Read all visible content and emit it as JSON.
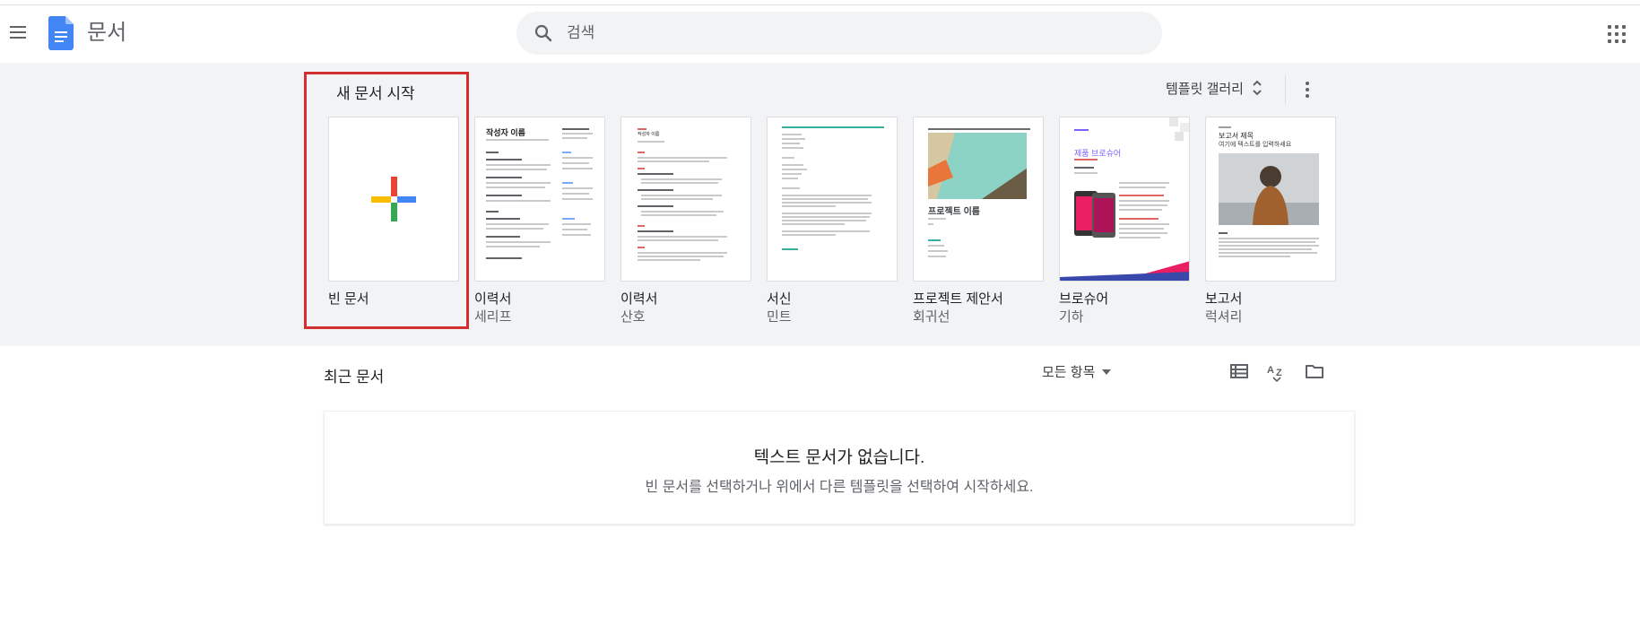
{
  "app": {
    "title": "문서",
    "menu_icon": "hamburger-menu-icon",
    "logo_icon": "docs-logo-icon",
    "apps_icon": "google-apps-grid-icon",
    "brand_color": "#4285f4"
  },
  "search": {
    "placeholder": "검색",
    "value": "",
    "icon": "search-icon"
  },
  "start": {
    "title": "새 문서 시작",
    "gallery_label": "템플릿 갤러리",
    "gallery_icon": "unfold-more-icon",
    "more_icon": "more-vert-icon",
    "highlight_color": "#d32f2f",
    "templates": [
      {
        "title": "빈 문서",
        "subtitle": ""
      },
      {
        "title": "이력서",
        "subtitle": "세리프",
        "thumb_text": "작성자 이름"
      },
      {
        "title": "이력서",
        "subtitle": "산호",
        "thumb_text": "작성자 이름"
      },
      {
        "title": "서신",
        "subtitle": "민트"
      },
      {
        "title": "프로젝트 제안서",
        "subtitle": "회귀선",
        "thumb_text": "프로젝트 이름"
      },
      {
        "title": "브로슈어",
        "subtitle": "기하",
        "thumb_text": "제품 브로슈어"
      },
      {
        "title": "보고서",
        "subtitle": "럭셔리",
        "thumb_text": "보고서 제목",
        "thumb_subtext": "여기에 텍스트를 입력하세요"
      }
    ]
  },
  "recent": {
    "title": "최근 문서",
    "filter_label": "모든 항목",
    "filter_icon": "dropdown-caret-icon",
    "view_icons": [
      "list-view-icon",
      "sort-az-icon",
      "folder-icon"
    ],
    "empty_title": "텍스트 문서가 없습니다.",
    "empty_desc": "빈 문서를 선택하거나 위에서 다른 템플릿을 선택하여 시작하세요."
  }
}
